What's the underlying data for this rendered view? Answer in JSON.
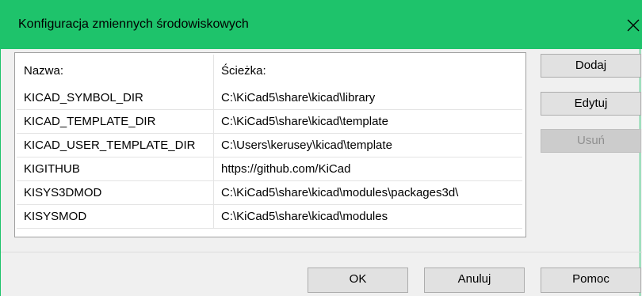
{
  "window": {
    "title": "Konfiguracja zmiennych środowiskowych"
  },
  "table": {
    "headers": [
      "Nazwa:",
      "Ścieżka:"
    ],
    "rows": [
      [
        "KICAD_SYMBOL_DIR",
        "C:\\KiCad5\\share\\kicad\\library"
      ],
      [
        "KICAD_TEMPLATE_DIR",
        "C:\\KiCad5\\share\\kicad\\template"
      ],
      [
        "KICAD_USER_TEMPLATE_DIR",
        "C:\\Users\\kerusey\\kicad\\template"
      ],
      [
        "KIGITHUB",
        "https://github.com/KiCad"
      ],
      [
        "KISYS3DMOD",
        "C:\\KiCad5\\share\\kicad\\modules\\packages3d\\"
      ],
      [
        "KISYSMOD",
        "C:\\KiCad5\\share\\kicad\\modules"
      ]
    ]
  },
  "side_buttons": {
    "add": "Dodaj",
    "edit": "Edytuj",
    "remove": "Usuń"
  },
  "footer_buttons": {
    "ok": "OK",
    "cancel": "Anuluj",
    "help": "Pomoc"
  },
  "colors": {
    "titlebar": "#1ec36b"
  }
}
